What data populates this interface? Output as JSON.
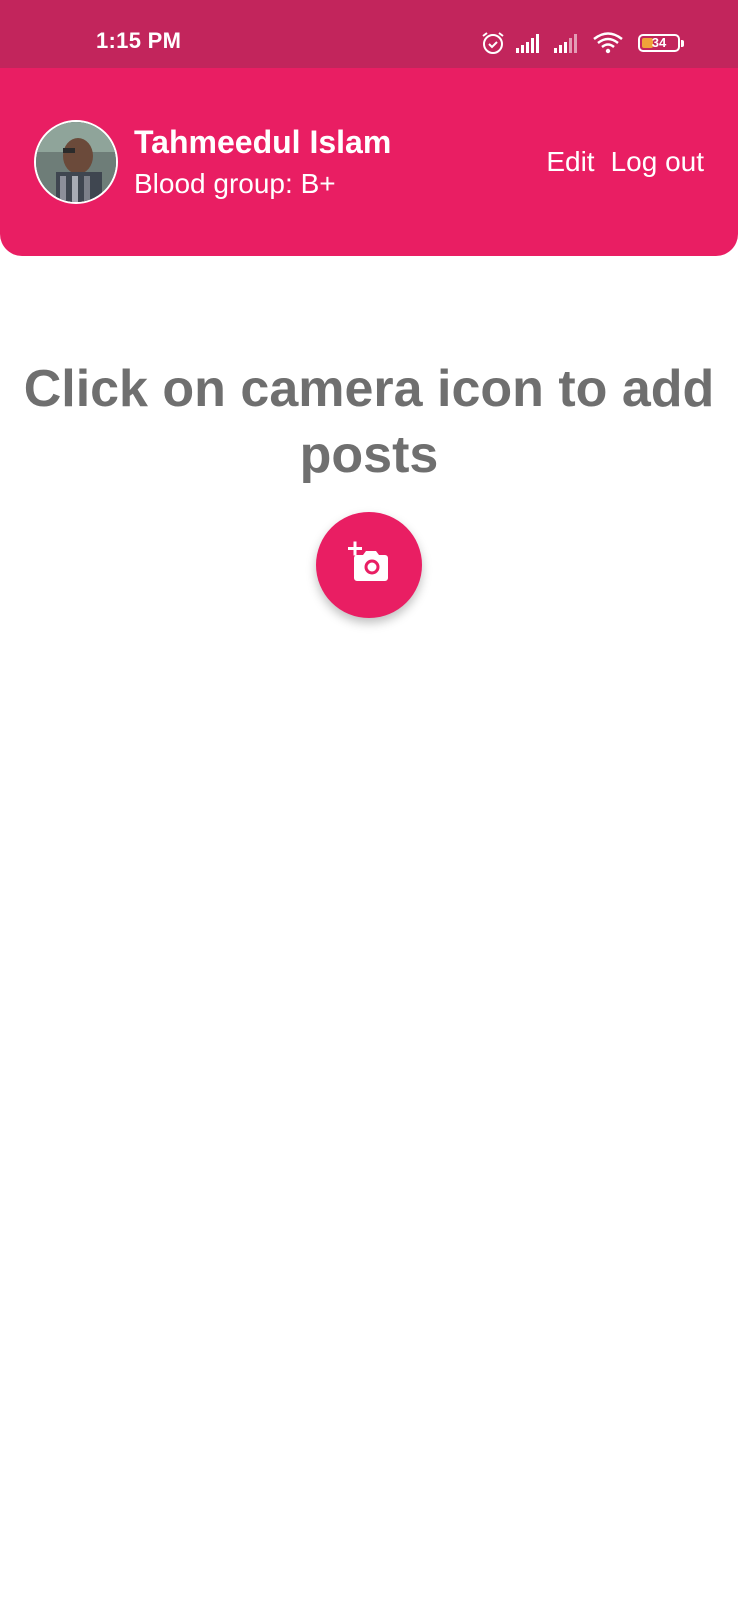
{
  "status_bar": {
    "time": "1:15 PM",
    "battery_level": "34",
    "icons": [
      "alarm-icon",
      "signal-icon",
      "signal-icon",
      "wifi-icon",
      "battery-icon"
    ],
    "background": "#c2255c"
  },
  "header": {
    "user_name": "Tahmeedul Islam",
    "blood_group": "Blood group: B+",
    "edit_label": "Edit",
    "logout_label": "Log out",
    "background": "#e91e63"
  },
  "main": {
    "empty_message": "Click on camera icon to add posts",
    "add_post_icon": "add-photo-icon",
    "text_color": "#6f6f6f"
  }
}
